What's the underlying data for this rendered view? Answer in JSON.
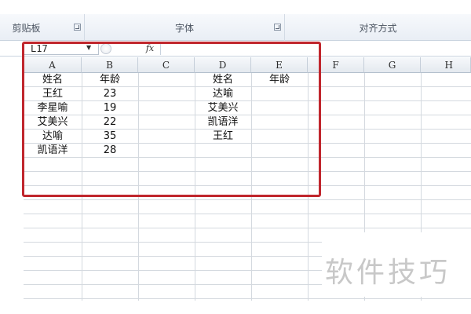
{
  "ribbon": {
    "groups": [
      {
        "label": "剪贴板"
      },
      {
        "label": "字体"
      },
      {
        "label": "对齐方式"
      }
    ]
  },
  "formula_bar": {
    "name_box": "L17",
    "fx_label": "fx",
    "value": ""
  },
  "columns": [
    "A",
    "B",
    "C",
    "D",
    "E",
    "F",
    "G",
    "H"
  ],
  "sheet": {
    "col_a": [
      "姓名",
      "王红",
      "李星喻",
      "艾美兴",
      "达喻",
      "凯语洋"
    ],
    "col_b": [
      "年龄",
      "23",
      "19",
      "22",
      "35",
      "28"
    ],
    "col_d": [
      "姓名",
      "达喻",
      "艾美兴",
      "凯语洋",
      "王红"
    ],
    "col_e": [
      "年龄"
    ]
  },
  "watermark": "软件技巧",
  "colors": {
    "highlight": "#c0262d",
    "gridline": "#d4d9df"
  }
}
